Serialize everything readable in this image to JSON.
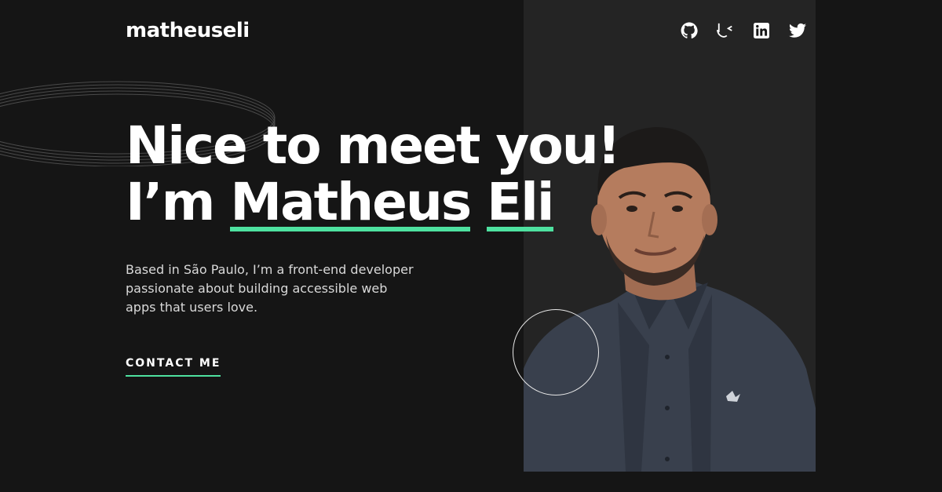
{
  "header": {
    "logo": "matheuseli",
    "socials": [
      {
        "icon": "github-icon"
      },
      {
        "icon": "frontend-mentor-icon"
      },
      {
        "icon": "linkedin-icon"
      },
      {
        "icon": "twitter-icon"
      }
    ]
  },
  "hero": {
    "line1": "Nice to meet you!",
    "line2_prefix": "I’m",
    "name_first": "Matheus",
    "name_last": "Eli",
    "description": "Based in São Paulo, I’m a front-end developer passionate about building accessible web apps that users love.",
    "cta_label": "CONTACT ME"
  },
  "colors": {
    "background": "#151515",
    "panel": "#242424",
    "accent": "#4ee1a0",
    "text": "#ffffff",
    "muted_text": "#d9d9d9"
  }
}
